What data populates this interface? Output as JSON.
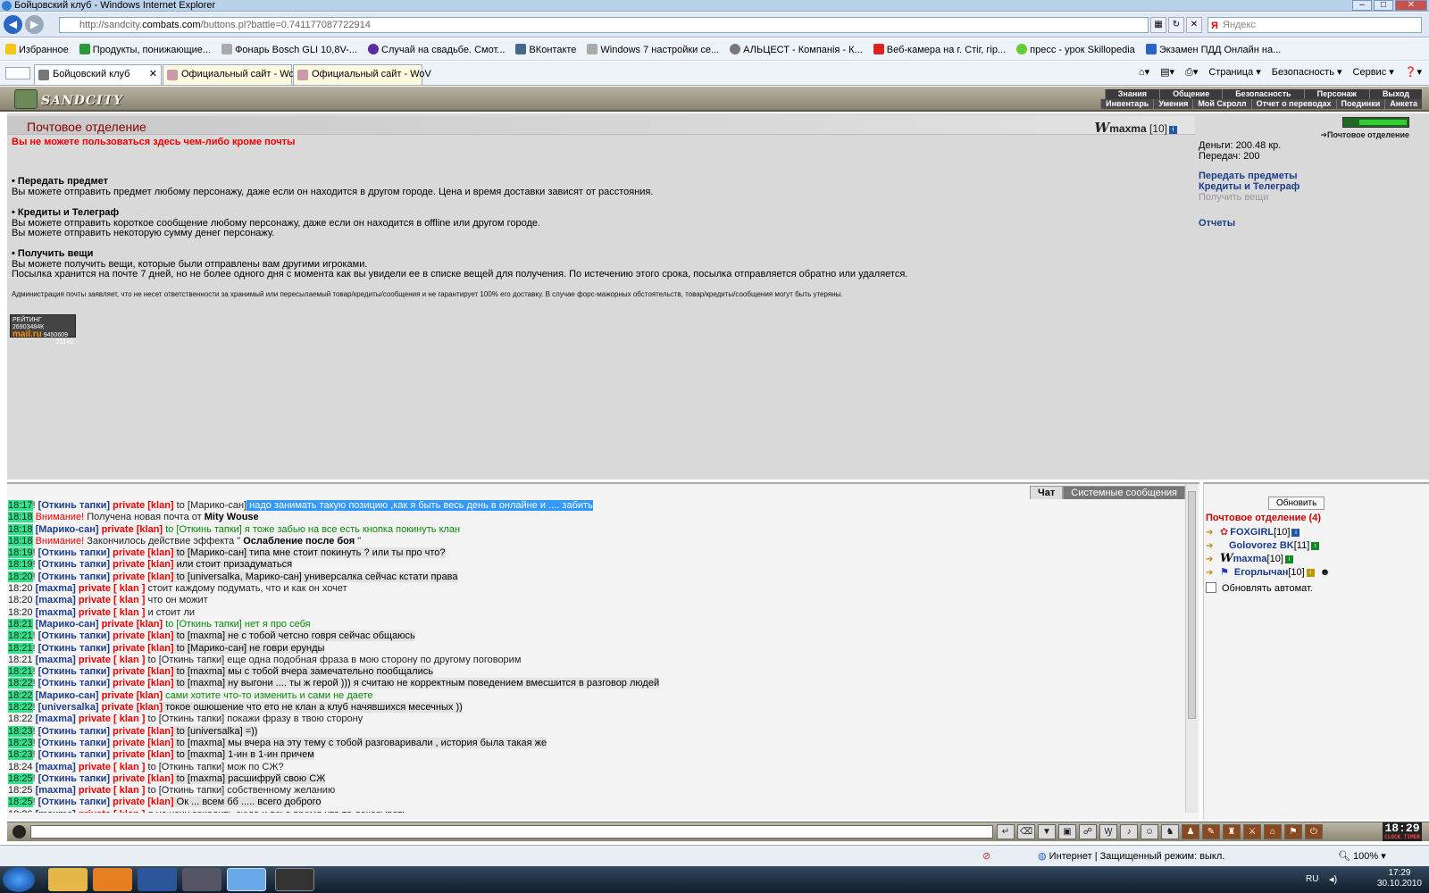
{
  "window": {
    "title": "Бойцовский клуб - Windows Internet Explorer"
  },
  "address": {
    "prefix": "http://sandcity.",
    "domain": "combats.com",
    "path": "/buttons.pl?battle=0.741177087722914"
  },
  "search": {
    "placeholder": "Яндекс"
  },
  "favorites": {
    "label": "Избранное",
    "items": [
      "Продукты, понижающие...",
      "Фонарь Bosch GLI 10,8V-...",
      "Случай на свадьбе. Смот...",
      "ВКонтакте",
      "Windows 7 настройки се...",
      "АЛЬЦЕСТ - Компанія - К...",
      "Веб-камера на г. Стіг, гір...",
      "пресс - урок Skillopedia",
      "Экзамен ПДД Онлайн на..."
    ]
  },
  "tabs": [
    "Бойцовский клуб",
    "Официальный сайт - WoV",
    "Официальный сайт - WoV"
  ],
  "commandbar": [
    "Страница ▾",
    "Безопасность ▾",
    "Сервис ▾",
    "❓▾"
  ],
  "game": {
    "logo": "SANDCITY",
    "menu_top": [
      "Знания",
      "Общение",
      "Безопасность",
      "Персонаж",
      "Выход"
    ],
    "menu_bottom": [
      "Инвентарь",
      "Умения",
      "Мой Скролл",
      "Отчет о переводах",
      "Поединки",
      "Анкета"
    ]
  },
  "page": {
    "title": "Почтовое отделение",
    "player_name": "maxma",
    "player_level": "[10]",
    "warning": "Вы не можете пользоваться здесь чем-либо кроме почты",
    "sections": [
      {
        "title": "• Передать предмет",
        "lines": [
          "Вы можете отправить предмет любому персонажу, даже если он находится в другом городе. Цена и время доставки зависят от расстояния."
        ]
      },
      {
        "title": "• Кредиты и Телеграф",
        "lines": [
          "Вы можете отправить короткое сообщение любому персонажу, даже если он находится в offline или другом городе.",
          "Вы можете отправить некоторую сумму денег персонажу."
        ]
      },
      {
        "title": "• Получить вещи",
        "lines": [
          "Вы можете получить вещи, которые были отправлены вам другими игроками.",
          "Посылка хранится на почте 7 дней, но не более одного дня с момента как вы увидели ее в списке вещей для получения. По истечению этого срока, посылка отправляется обратно или удаляется."
        ]
      }
    ],
    "disclaimer": "Администрация почты заявляет, что не несет ответственности за хранимый или пересылаемый товар/кредиты/сообщения и не гарантирует 100% его доставку. В случае форс-мажорных обстоятельств, товар/кредиты/сообщения могут быть утеряны.",
    "counter": {
      "line1": "РЕЙТИНГ 26903484К",
      "brand": "mail.ru",
      "line2": "9450609",
      "line3": "21149"
    }
  },
  "sidebar": {
    "location": "Почтовое отделение",
    "money": "Деньги: 200.48 кр.",
    "transfers": "Передач: 200",
    "links": [
      "Передать предметы",
      "Кредиты и Телеграф",
      "Получить вещи",
      "Отчеты"
    ]
  },
  "chat": {
    "tabs": [
      "Чат",
      "Системные сообщения"
    ],
    "messages": [
      {
        "time": "18:17",
        "hl": true,
        "parts": [
          [
            "!",
            "to"
          ],
          [
            "[Откинь тапки]",
            "nm"
          ],
          [
            "private [klan]",
            "pv"
          ],
          [
            "to [Марико-сан]",
            "to"
          ],
          [
            "надо занимать такую позицию ,как я быть весь день в онлайне и .... забить",
            "sel"
          ]
        ]
      },
      {
        "time": "18:18",
        "hl": true,
        "parts": [
          [
            "Внимание!",
            "att"
          ],
          [
            "Получена новая почта от",
            "to"
          ],
          [
            "Mity Wouse",
            "b"
          ]
        ]
      },
      {
        "time": "18:18",
        "hl": true,
        "parts": [
          [
            "[Марико-сан]",
            "nm"
          ],
          [
            "private [klan]",
            "pv"
          ],
          [
            "to [Откинь тапки] я тоже забью на все есть кнопка покинуть клан",
            "g"
          ]
        ]
      },
      {
        "time": "18:18",
        "hl": true,
        "parts": [
          [
            "Внимание!",
            "att"
          ],
          [
            "Закончилось действие эффекта \"",
            "to"
          ],
          [
            "Ослабление после боя",
            "b"
          ],
          [
            "\"",
            "to"
          ]
        ]
      },
      {
        "time": "18:19",
        "hl": true,
        "parts": [
          [
            "!",
            "to"
          ],
          [
            "[Откинь тапки]",
            "nm"
          ],
          [
            "private [klan]",
            "pv"
          ],
          [
            "to [Марико-сан] типа мне стоит покинуть ? или ты про что?",
            "bg"
          ]
        ]
      },
      {
        "time": "18:19",
        "hl": true,
        "parts": [
          [
            "!",
            "to"
          ],
          [
            "[Откинь тапки]",
            "nm"
          ],
          [
            "private [klan]",
            "pv"
          ],
          [
            "или стоит призадуматься",
            "bg"
          ]
        ]
      },
      {
        "time": "18:20",
        "hl": true,
        "parts": [
          [
            "!",
            "to"
          ],
          [
            "[Откинь тапки]",
            "nm"
          ],
          [
            "private [klan]",
            "pv"
          ],
          [
            "to [universalka, Марико-сан] универсалка сейчас кстати права",
            "bg"
          ]
        ]
      },
      {
        "time": "18:20",
        "hl": false,
        "parts": [
          [
            "[maxma]",
            "nm"
          ],
          [
            "private [ klan ]",
            "pv"
          ],
          [
            "стоит каждому подумать, что и как он хочет",
            "to"
          ]
        ]
      },
      {
        "time": "18:20",
        "hl": false,
        "parts": [
          [
            "[maxma]",
            "nm"
          ],
          [
            "private [ klan ]",
            "pv"
          ],
          [
            "что он можит",
            "to"
          ]
        ]
      },
      {
        "time": "18:20",
        "hl": false,
        "parts": [
          [
            "[maxma]",
            "nm"
          ],
          [
            "private [ klan ]",
            "pv"
          ],
          [
            "и стоит ли",
            "to"
          ]
        ]
      },
      {
        "time": "18:21",
        "hl": true,
        "parts": [
          [
            "[Марико-сан]",
            "nm"
          ],
          [
            "private [klan]",
            "pv"
          ],
          [
            "to [Откинь тапки] нет я про себя",
            "g"
          ]
        ]
      },
      {
        "time": "18:21",
        "hl": true,
        "parts": [
          [
            "!",
            "to"
          ],
          [
            "[Откинь тапки]",
            "nm"
          ],
          [
            "private [klan]",
            "pv"
          ],
          [
            "to [maxma] не с тобой четсно говря сейчас общаюсь",
            "bg"
          ]
        ]
      },
      {
        "time": "18:21",
        "hl": true,
        "parts": [
          [
            "!",
            "to"
          ],
          [
            "[Откинь тапки]",
            "nm"
          ],
          [
            "private [klan]",
            "pv"
          ],
          [
            "to [Марико-сан] не говри ерунды",
            "bg"
          ]
        ]
      },
      {
        "time": "18:21",
        "hl": false,
        "parts": [
          [
            "[maxma]",
            "nm"
          ],
          [
            "private [ klan ]",
            "pv"
          ],
          [
            "to [Откинь тапки] еще одна подобная фраза в мою сторону по другому поговорим",
            "to"
          ]
        ]
      },
      {
        "time": "18:21",
        "hl": true,
        "parts": [
          [
            "!",
            "to"
          ],
          [
            "[Откинь тапки]",
            "nm"
          ],
          [
            "private [klan]",
            "pv"
          ],
          [
            "to [maxma] мы с тобой вчера замечательно пообщались",
            "bg"
          ]
        ]
      },
      {
        "time": "18:22",
        "hl": true,
        "parts": [
          [
            "!",
            "to"
          ],
          [
            "[Откинь тапки]",
            "nm"
          ],
          [
            "private [klan]",
            "pv"
          ],
          [
            "to [maxma] ну выгони .... ты ж герой ))) я считаю не корректным поведением вмесшится в разговор людей",
            "bg"
          ]
        ]
      },
      {
        "time": "18:22",
        "hl": true,
        "parts": [
          [
            "[Марико-сан]",
            "nm"
          ],
          [
            "private [klan]",
            "pv"
          ],
          [
            "сами хотите что-то изменить и сами не даете",
            "g"
          ]
        ]
      },
      {
        "time": "18:22",
        "hl": true,
        "parts": [
          [
            "!",
            "to"
          ],
          [
            "[universalka]",
            "nm"
          ],
          [
            "private [klan]",
            "pv"
          ],
          [
            "токое ошюшение что ето не клан а клуб начявшихся месечных ))",
            "bg"
          ]
        ]
      },
      {
        "time": "18:22",
        "hl": false,
        "parts": [
          [
            "[maxma]",
            "nm"
          ],
          [
            "private [ klan ]",
            "pv"
          ],
          [
            "to [Откинь тапки] покажи фразу в твою сторону",
            "to"
          ]
        ]
      },
      {
        "time": "18:23",
        "hl": true,
        "parts": [
          [
            "!",
            "to"
          ],
          [
            "[Откинь тапки]",
            "nm"
          ],
          [
            "private [klan]",
            "pv"
          ],
          [
            "to [universalka] =))",
            "bg"
          ]
        ]
      },
      {
        "time": "18:23",
        "hl": true,
        "parts": [
          [
            "!",
            "to"
          ],
          [
            "[Откинь тапки]",
            "nm"
          ],
          [
            "private [klan]",
            "pv"
          ],
          [
            "to [maxma] мы вчера на эту тему с тобой разговаривали , история была такая же",
            "bg"
          ]
        ]
      },
      {
        "time": "18:23",
        "hl": true,
        "parts": [
          [
            "!",
            "to"
          ],
          [
            "[Откинь тапки]",
            "nm"
          ],
          [
            "private [klan]",
            "pv"
          ],
          [
            "to [maxma] 1-ин в 1-ин причем",
            "bg"
          ]
        ]
      },
      {
        "time": "18:24",
        "hl": false,
        "parts": [
          [
            "[maxma]",
            "nm"
          ],
          [
            "private [ klan ]",
            "pv"
          ],
          [
            "to [Откинь тапки] мож по СЖ?",
            "to"
          ]
        ]
      },
      {
        "time": "18:25",
        "hl": true,
        "parts": [
          [
            "!",
            "to"
          ],
          [
            "[Откинь тапки]",
            "nm"
          ],
          [
            "private [klan]",
            "pv"
          ],
          [
            "to [maxma] расшифруй свою СЖ",
            "bg"
          ]
        ]
      },
      {
        "time": "18:25",
        "hl": false,
        "parts": [
          [
            "[maxma]",
            "nm"
          ],
          [
            "private [ klan ]",
            "pv"
          ],
          [
            "to [Откинь тапки] собственному желанию",
            "to"
          ]
        ]
      },
      {
        "time": "18:25",
        "hl": true,
        "parts": [
          [
            "!",
            "to"
          ],
          [
            "[Откинь тапки]",
            "nm"
          ],
          [
            "private [klan]",
            "pv"
          ],
          [
            "Ок ... всем бб ..... всего доброго",
            "bg"
          ]
        ]
      },
      {
        "time": "18:26",
        "hl": false,
        "parts": [
          [
            "[maxma]",
            "nm"
          ],
          [
            "private [ klan ]",
            "pv"
          ],
          [
            "я не хочу заходить сюда и всьо время что то доказывать",
            "to"
          ]
        ]
      }
    ]
  },
  "online": {
    "refresh": "Обновить",
    "title": "Почтовое отделение (4)",
    "users": [
      {
        "name": "FOXGIRL",
        "level": "[10]"
      },
      {
        "name": "Golovorez BK",
        "level": "[11]"
      },
      {
        "name": "maxma",
        "level": "[10]"
      },
      {
        "name": "Егорлычан",
        "level": "[10]"
      }
    ],
    "auto": "Обновлять автомат."
  },
  "clock": {
    "time": "18:29",
    "label": "CLOCK TIMER"
  },
  "status": {
    "zone": "Интернет | Защищенный режим: выкл.",
    "zoom": "100%"
  },
  "taskbar": {
    "lang": "RU",
    "time": "17:29",
    "date": "30.10.2010"
  }
}
